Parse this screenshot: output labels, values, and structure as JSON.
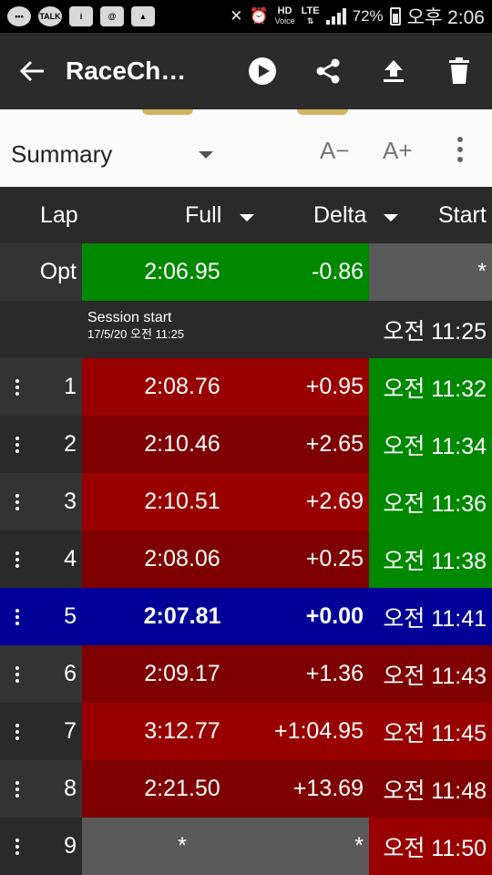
{
  "status_bar": {
    "left_icons": [
      "more-icon",
      "talk-icon",
      "info-icon",
      "mail-icon",
      "image-icon"
    ],
    "left_labels": [
      "•••",
      "TALK",
      "i",
      "@",
      "▲"
    ],
    "mute_glyph": "✕",
    "alarm_glyph": "⏰",
    "hd": "HD",
    "voice": "Voice",
    "lte": "LTE",
    "lte_arrows": "⇅",
    "battery": "72%",
    "time": "오후 2:06"
  },
  "app_bar": {
    "title": "RaceCh…",
    "icons": [
      "back-arrow-icon",
      "play-icon",
      "share-icon",
      "upload-icon",
      "delete-icon"
    ]
  },
  "summary_bar": {
    "view_label": "Summary",
    "font_decrease": "A−",
    "font_increase": "A+"
  },
  "table": {
    "headers": {
      "lap": "Lap",
      "full": "Full",
      "delta": "Delta",
      "start": "Start"
    },
    "optimal": {
      "lap": "Opt",
      "full": "2:06.95",
      "delta": "-0.86",
      "start": "*"
    },
    "session": {
      "title": "Session start",
      "date": "17/5/20 오전 11:25",
      "start": "오전 11:25"
    },
    "rows": [
      {
        "lap": "1",
        "full": "2:08.76",
        "delta": "+0.95",
        "start": "오전 11:32"
      },
      {
        "lap": "2",
        "full": "2:10.46",
        "delta": "+2.65",
        "start": "오전 11:34"
      },
      {
        "lap": "3",
        "full": "2:10.51",
        "delta": "+2.69",
        "start": "오전 11:36"
      },
      {
        "lap": "4",
        "full": "2:08.06",
        "delta": "+0.25",
        "start": "오전 11:38"
      },
      {
        "lap": "5",
        "full": "2:07.81",
        "delta": "+0.00",
        "start": "오전 11:41"
      },
      {
        "lap": "6",
        "full": "2:09.17",
        "delta": "+1.36",
        "start": "오전 11:43"
      },
      {
        "lap": "7",
        "full": "3:12.77",
        "delta": "+1:04.95",
        "start": "오전 11:45"
      },
      {
        "lap": "8",
        "full": "2:21.50",
        "delta": "+13.69",
        "start": "오전 11:48"
      },
      {
        "lap": "9",
        "full": "*",
        "delta": "*",
        "start": "오전 11:50"
      }
    ]
  },
  "colors": {
    "green": "#008800",
    "red_light": "#990000",
    "red_dark": "#7f0000",
    "blue": "#000099",
    "grey_cell": "#5a5a5a",
    "lap_col": "#333333",
    "lap_col_alt": "#2a2a2a"
  }
}
